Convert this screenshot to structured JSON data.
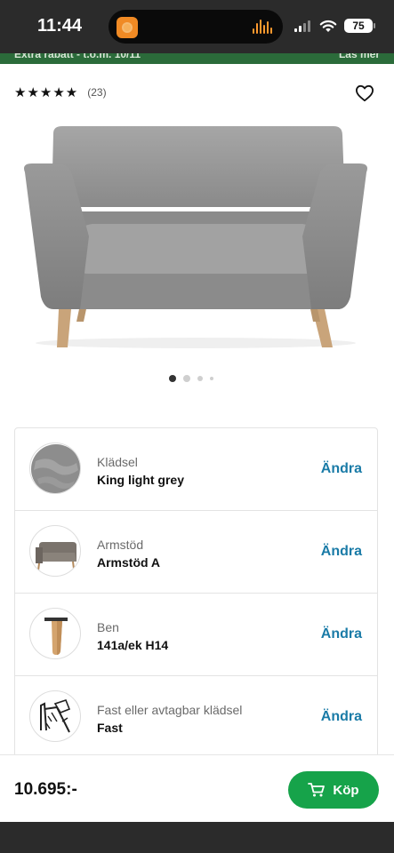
{
  "status_bar": {
    "time": "11:44",
    "battery": "75"
  },
  "promo": {
    "left": "Extra rabatt - t.o.m. 10/11",
    "right": "Läs mer"
  },
  "product": {
    "rating_count": "(23)",
    "gallery_dots": 4,
    "gallery_active": 1
  },
  "options": [
    {
      "label": "Klädsel",
      "value": "King light grey",
      "action": "Ändra",
      "icon": "fabric-swatch-icon"
    },
    {
      "label": "Armstöd",
      "value": "Armstöd A",
      "action": "Ändra",
      "icon": "armrest-sofa-icon"
    },
    {
      "label": "Ben",
      "value": "141a/ek H14",
      "action": "Ändra",
      "icon": "wooden-leg-icon"
    },
    {
      "label": "Fast eller avtagbar klädsel",
      "value": "Fast",
      "action": "Ändra",
      "icon": "upholstery-type-icon"
    }
  ],
  "footer": {
    "price": "10.695:-",
    "buy_label": "Köp"
  },
  "colors": {
    "buy_button": "#16a34a",
    "change_link": "#1a7ba7",
    "promo_bar": "#2b6b3a"
  }
}
